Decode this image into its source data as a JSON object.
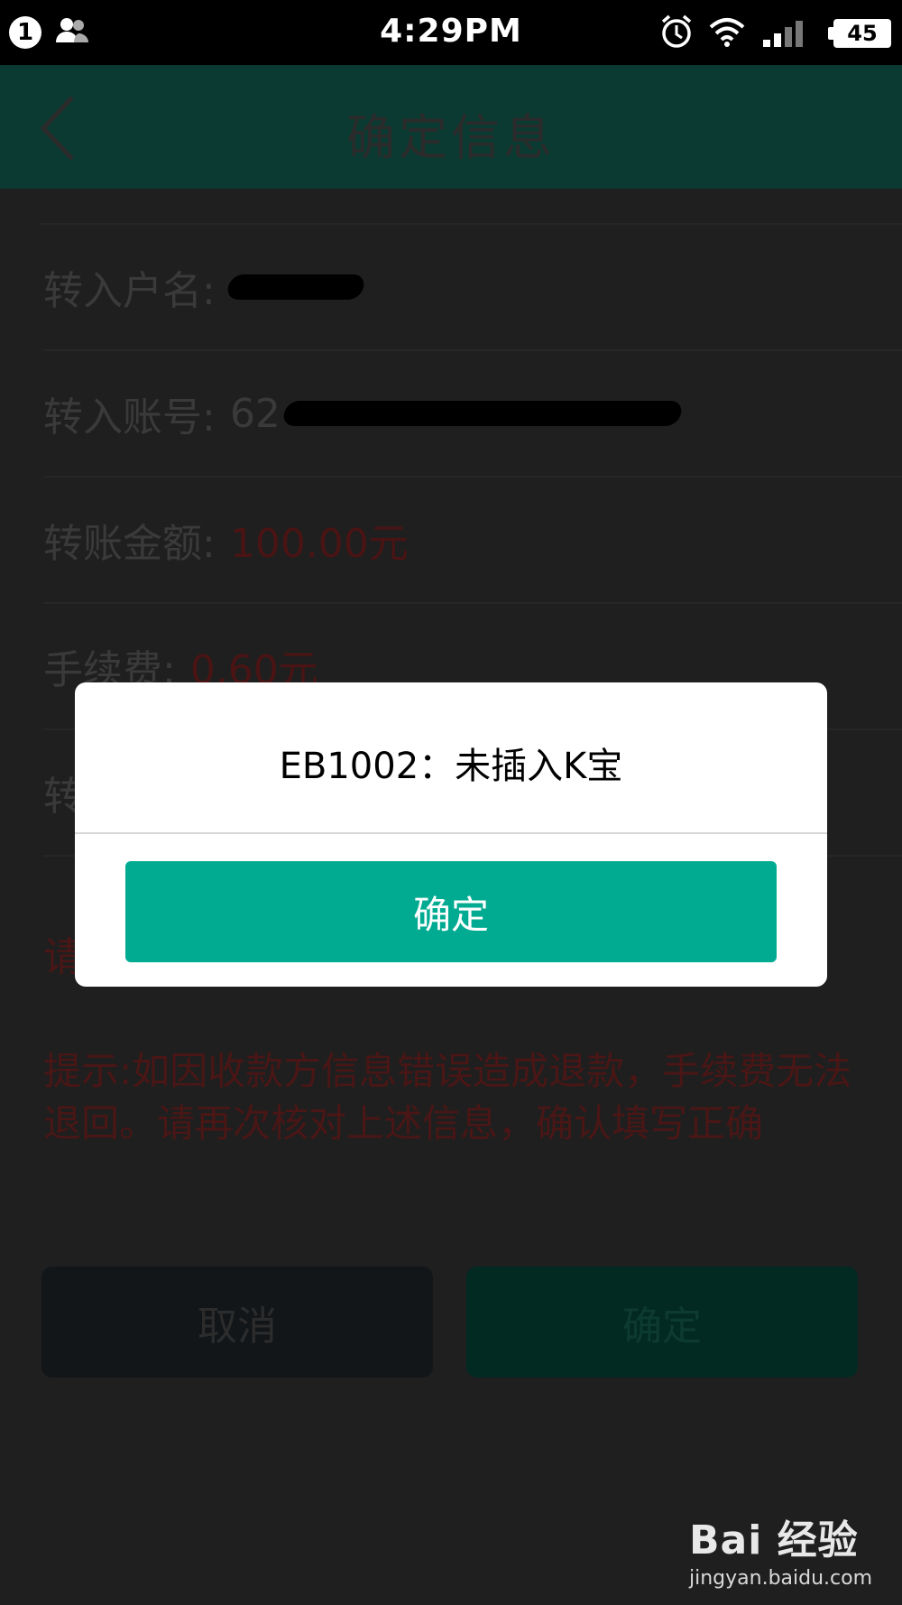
{
  "status_bar": {
    "notification_count": "1",
    "time": "4:29PM",
    "battery": "45"
  },
  "appbar": {
    "title": "确定信息"
  },
  "rows": [
    {
      "label": "转入户名:",
      "value": ""
    },
    {
      "label": "转入账号:",
      "value": "62"
    },
    {
      "label": "转账金额:",
      "value": "100.00元"
    },
    {
      "label": "手续费:",
      "value": "0.60元"
    },
    {
      "label": "转",
      "value": ""
    }
  ],
  "partial_text": "请",
  "notice": "提示:如因收款方信息错误造成退款，手续费无法退回。请再次核对上述信息，确认填写正确",
  "buttons": {
    "cancel": "取消",
    "confirm": "确定"
  },
  "dialog": {
    "message": "EB1002：未插入K宝",
    "ok": "确定"
  },
  "watermark": {
    "main": "Bai  经验",
    "sub": "jingyan.baidu.com"
  }
}
